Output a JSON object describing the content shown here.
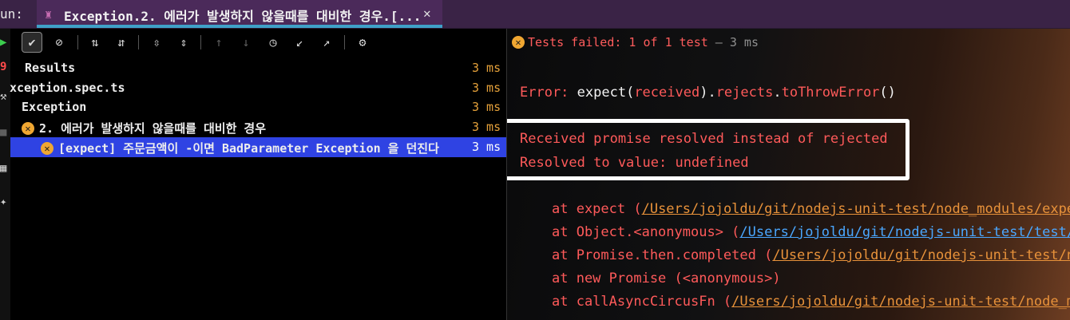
{
  "run_label": "un:",
  "tab": {
    "title": "Exception.2. 에러가 발생하지 않을때를 대비한 경우.[...",
    "close": "✕"
  },
  "status": {
    "text": "Tests failed: 1 of 1 test",
    "sep": " – ",
    "duration": "3 ms"
  },
  "tree": [
    {
      "label": "Results",
      "time": "3 ms",
      "status": "none",
      "selected": false
    },
    {
      "label": "xception.spec.ts",
      "time": "3 ms",
      "status": "none",
      "selected": false
    },
    {
      "label": "Exception",
      "time": "3 ms",
      "status": "none",
      "selected": false
    },
    {
      "label": "2. 에러가 발생하지 않을때를 대비한 경우",
      "time": "3 ms",
      "status": "failed",
      "selected": false
    },
    {
      "label": "[expect] 주문금액이 -이면 BadParameter Exception 을 던진다",
      "time": "3 ms",
      "status": "failed",
      "selected": true
    }
  ],
  "output": {
    "error_prefix": "Error: ",
    "error_expect": "expect(",
    "error_received": "received",
    "error_mid": ").",
    "error_rejects": "rejects",
    "error_dot": ".",
    "error_method": "toThrowError",
    "error_end": "()",
    "received_line": "Received promise resolved instead of rejected",
    "resolved_line": "Resolved to value: undefined",
    "stack": [
      {
        "prefix": "at expect (",
        "path": "/Users/jojoldu/git/nodejs-unit-test/node_modules/expec",
        "suffix": "",
        "blue": false
      },
      {
        "prefix": "at Object.<anonymous> (",
        "path": "/Users/jojoldu/git/nodejs-unit-test/test/e",
        "suffix": "",
        "blue": true
      },
      {
        "prefix": "at Promise.then.completed (",
        "path": "/Users/jojoldu/git/nodejs-unit-test/no",
        "suffix": "",
        "blue": false
      },
      {
        "prefix": "at new Promise (<anonymous>)",
        "path": "",
        "suffix": "",
        "blue": false
      },
      {
        "prefix": "at callAsyncCircusFn (",
        "path": "/Users/jojoldu/git/nodejs-unit-test/node_mo",
        "suffix": "",
        "blue": false
      }
    ]
  },
  "colors": {
    "selection": "#2f43e3",
    "failed": "#f0a732",
    "error_text": "#ff5a5a",
    "path": "#e8923a",
    "tab_bg": "#4b2a5a"
  },
  "icons": [
    "run-icon",
    "error-icon",
    "wrench-icon",
    "stop-icon",
    "layout-icon",
    "pin-icon",
    "check-icon",
    "ban-icon",
    "sort-alpha-icon",
    "sort-duration-icon",
    "expand-all-icon",
    "collapse-all-icon",
    "arrow-up-icon",
    "arrow-down-icon",
    "history-icon",
    "import-icon",
    "export-icon",
    "gear-icon"
  ]
}
